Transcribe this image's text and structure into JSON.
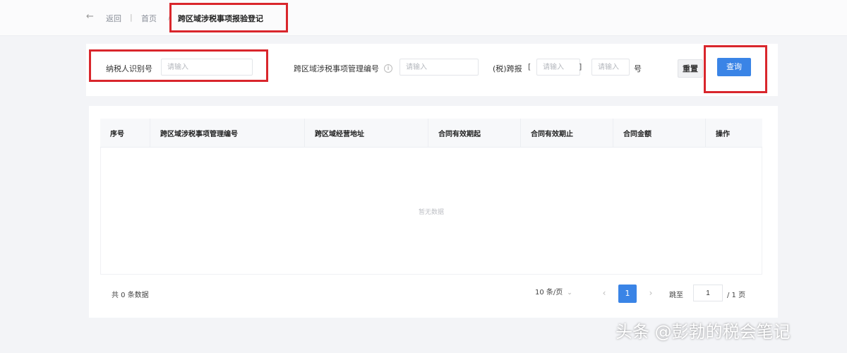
{
  "breadcrumb": {
    "back_label": "返回",
    "home": "首页",
    "current": "跨区域涉税事项报验登记"
  },
  "filters": {
    "taxpayer_id_label": "纳税人识别号",
    "taxpayer_id_placeholder": "请输入",
    "mgmt_no_label": "跨区域涉税事项管理编号",
    "mgmt_no_placeholder": "请输入",
    "doc_no_label": "(税)跨报",
    "doc_no_open": "[",
    "doc_no_year_placeholder": "请输入",
    "doc_no_close": "]",
    "doc_no_seq_placeholder": "请输入",
    "doc_no_suffix": "号",
    "reset_label": "重置",
    "query_label": "查询"
  },
  "table": {
    "columns": [
      "序号",
      "跨区域涉税事项管理编号",
      "跨区域经营地址",
      "合同有效期起",
      "合同有效期止",
      "合同金额",
      "操作"
    ],
    "empty_text": "暂无数据"
  },
  "pagination": {
    "total_text": "共 0 条数据",
    "page_size": "10 条/页",
    "current_page": "1",
    "jump_label": "跳至",
    "jump_value": "1",
    "total_pages": "/ 1 页"
  },
  "watermark": "头条 @彭勃的税会笔记",
  "colors": {
    "primary": "#3a84e6",
    "highlight_box": "#d9262c"
  }
}
